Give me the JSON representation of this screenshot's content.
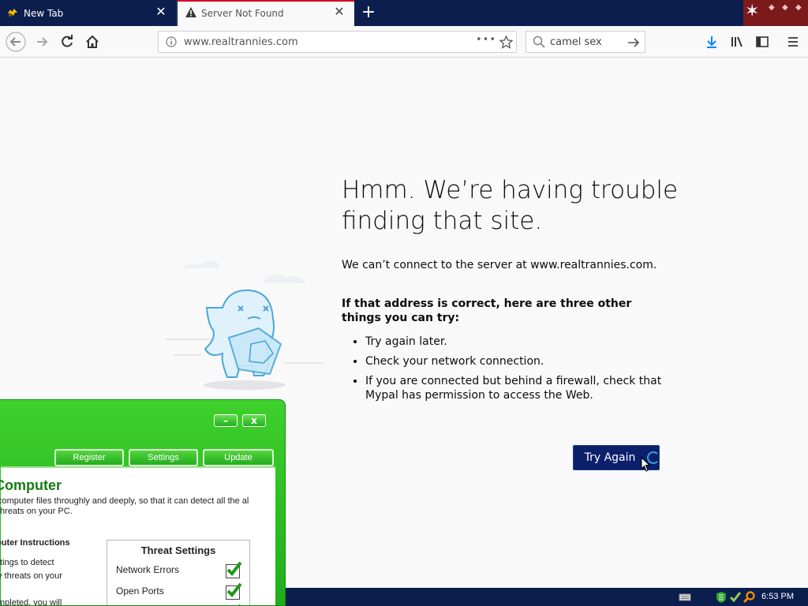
{
  "tabs": [
    {
      "title": "New Tab",
      "close": "✕"
    },
    {
      "title": "Server Not Found",
      "close": "✕"
    }
  ],
  "new_tab_label": "+",
  "toolbar": {
    "url": "www.realtrannies.com",
    "page_actions": "•••",
    "search_value": "camel sex"
  },
  "error": {
    "title": "Hmm. We’re having trouble finding that site.",
    "description": "We can’t connect to the server at www.realtrannies.com.",
    "suggestions_heading": "If that address is correct, here are three other things you can try:",
    "suggestions": [
      "Try again later.",
      "Check your network connection.",
      "If you are connected but behind a firewall, check that Mypal has permission to access the Web."
    ],
    "try_again": "Try Again"
  },
  "popup": {
    "minimize": "–",
    "close": "x",
    "tabs": [
      "Register",
      "Settings",
      "Update"
    ],
    "heading": "Computer",
    "description": "computer files throughly and deeply, so that it can detect all the al threats on your PC.",
    "instructions_heading": "puter Instructions",
    "instructions_lines": [
      "ttings to detect",
      "y threats on your",
      "",
      "mpleted, you will"
    ],
    "threat_settings": {
      "title": "Threat Settings",
      "rows": [
        {
          "label": "Network Errors",
          "checked": true
        },
        {
          "label": "Open Ports",
          "checked": true
        },
        {
          "label": "",
          "checked": true
        }
      ]
    }
  },
  "taskbar": {
    "clock": "6:53 PM"
  },
  "colors": {
    "tabbar": "#0c1e4e",
    "accent": "#0b1f6b",
    "popup_green": "#2dbf23"
  }
}
